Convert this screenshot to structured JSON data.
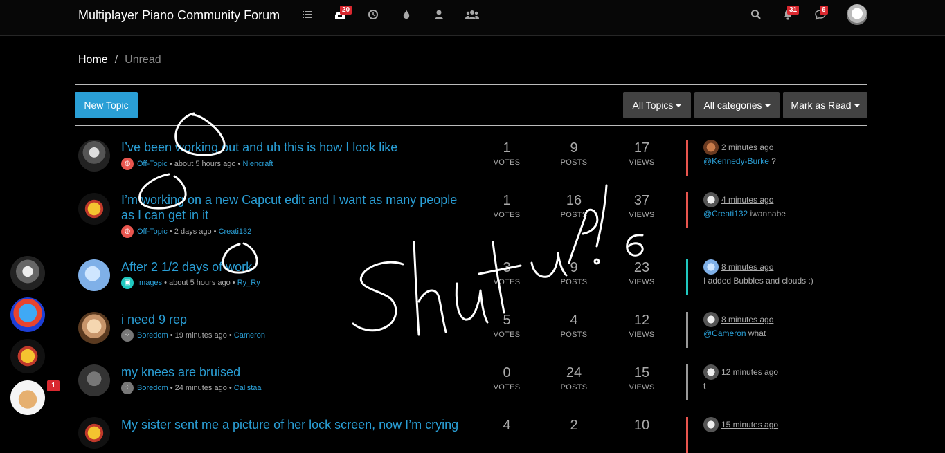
{
  "header": {
    "brand": "Multiplayer Piano Community Forum",
    "nav_icons": [
      "list-icon",
      "inbox-icon",
      "clock-icon",
      "fire-icon",
      "user-icon",
      "users-icon"
    ],
    "unread_badge": "20",
    "notifications_badge": "31",
    "chat_badge": "6"
  },
  "breadcrumb": {
    "home": "Home",
    "separator": "/",
    "current": "Unread"
  },
  "toolbar": {
    "new_topic": "New Topic",
    "filter_topics": "All Topics",
    "filter_categories": "All categories",
    "mark_read": "Mark as Read"
  },
  "stat_labels": {
    "votes": "VOTES",
    "posts": "POSTS",
    "views": "VIEWS"
  },
  "topics": [
    {
      "title": "I’ve been working out and uh this is how I look like",
      "category": "Off-Topic",
      "category_color": "#e8554e",
      "age": "about 5 hours ago",
      "author": "Niencraft",
      "votes": "1",
      "posts": "9",
      "views": "17",
      "last_time": "2 minutes ago",
      "last_user": "@Kennedy-Burke",
      "last_text": " ?",
      "bar_color": "#e8554e"
    },
    {
      "title": "I’m working on a new Capcut edit and I want as many people as I can get in it",
      "category": "Off-Topic",
      "category_color": "#e8554e",
      "age": "2 days ago",
      "author": "Creati132",
      "votes": "1",
      "posts": "16",
      "views": "37",
      "last_time": "4 minutes ago",
      "last_user": "@Creati132",
      "last_text": " iwannabe",
      "bar_color": "#e8554e"
    },
    {
      "title": "After 2 1/2 days of work",
      "category": "Images",
      "category_color": "#20c9c0",
      "age": "about 5 hours ago",
      "author": "Ry_Ry",
      "votes": "3",
      "posts": "9",
      "views": "23",
      "last_time": "8 minutes ago",
      "last_user": "",
      "last_text": "I added Bubbles and clouds :)",
      "bar_color": "#20c9c0"
    },
    {
      "title": "i need 9 rep",
      "category": "Boredom",
      "category_color": "#777777",
      "age": "19 minutes ago",
      "author": "Cameron",
      "votes": "5",
      "posts": "4",
      "views": "12",
      "last_time": "8 minutes ago",
      "last_user": "@Cameron",
      "last_text": " what",
      "bar_color": "#999999"
    },
    {
      "title": "my knees are bruised",
      "category": "Boredom",
      "category_color": "#777777",
      "age": "24 minutes ago",
      "author": "Calistaa",
      "votes": "0",
      "posts": "24",
      "views": "15",
      "last_time": "12 minutes ago",
      "last_user": "",
      "last_text": "t",
      "bar_color": "#999999"
    },
    {
      "title": "My sister sent me a picture of her lock screen, now I’m crying",
      "category": "",
      "category_color": "#e8554e",
      "age": "",
      "author": "",
      "votes": "4",
      "posts": "2",
      "views": "10",
      "last_time": "15 minutes ago",
      "last_user": "",
      "last_text": "",
      "bar_color": "#e8554e"
    }
  ],
  "sidebar_chat_badge": "1",
  "scribble_text": "Shut up! 6"
}
